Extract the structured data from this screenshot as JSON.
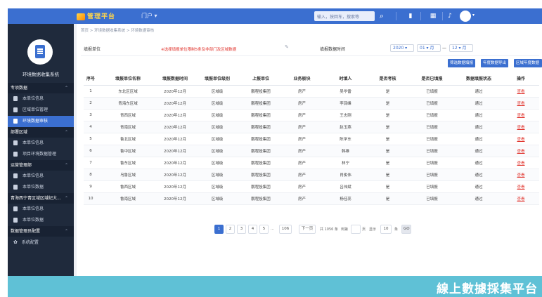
{
  "app": {
    "logo_text": "管理平台",
    "top_menu": "门户 ▾"
  },
  "header": {
    "search_placeholder": "输入，按回车，搜索等"
  },
  "sidebar": {
    "title": "环境数据收集系统",
    "groups": [
      {
        "label": "专项数据",
        "items": [
          {
            "label": "本单位信息"
          },
          {
            "label": "区域单位管理"
          },
          {
            "label": "环境数据审核",
            "active": true
          }
        ]
      },
      {
        "label": "部署区域",
        "items": [
          {
            "label": "本单位信息"
          },
          {
            "label": "项目环境数据管理"
          }
        ]
      },
      {
        "label": "运营管理部",
        "items": [
          {
            "label": "本单位信息"
          },
          {
            "label": "本单位数据"
          }
        ]
      },
      {
        "label": "青海西宁青区域区域纪大...",
        "items": [
          {
            "label": "本单位信息"
          },
          {
            "label": "本单位数据"
          }
        ]
      },
      {
        "label": "数据管理员配置",
        "items": [
          {
            "label": "系统配置",
            "gear": true
          }
        ]
      }
    ]
  },
  "breadcrumb": "首页 > 环境数据收集系统 > 环境数据审核",
  "filter": {
    "unit_label": "填报单位",
    "warning": "※选择填报单位限制5条及非部门及区域数据",
    "time_label": "填报数据时间",
    "year": "2020 ▾",
    "month_from": "01 ▾ 月",
    "dash": "—",
    "month_to": "12 ▾ 月"
  },
  "actions": [
    "筛选数据填报",
    "年度数据导出",
    "区域年度数据导出"
  ],
  "table": {
    "headers": [
      "序号",
      "填报单位名称",
      "填报数据时间",
      "填报单位级别",
      "上报单位",
      "业务板块",
      "时填人",
      "是否考核",
      "是否已填报",
      "数据填报状态",
      "操作"
    ],
    "rows": [
      [
        "1",
        "东北区区域",
        "2020年12月",
        "区域级",
        "鹏程投集团",
        "房产",
        "吴华雷",
        "是",
        "已填报",
        "通过",
        "查看"
      ],
      [
        "2",
        "青海东区域",
        "2020年12月",
        "区域级",
        "鹏程投集团",
        "房产",
        "李润峰",
        "是",
        "已填报",
        "通过",
        "查看"
      ],
      [
        "3",
        "青西区域",
        "2020年12月",
        "区域级",
        "鹏程投集团",
        "房产",
        "王志刚",
        "是",
        "已填报",
        "通过",
        "查看"
      ],
      [
        "4",
        "青南区域",
        "2020年12月",
        "区域级",
        "鹏程投集团",
        "房产",
        "赵玉燕",
        "是",
        "已填报",
        "通过",
        "查看"
      ],
      [
        "5",
        "鲁北区域",
        "2020年12月",
        "区域级",
        "鹏程投集团",
        "房产",
        "陈学东",
        "是",
        "已填报",
        "通过",
        "查看"
      ],
      [
        "6",
        "鲁中区域",
        "2020年12月",
        "区域级",
        "鹏程投集团",
        "房产",
        "韩雄",
        "是",
        "已填报",
        "通过",
        "查看"
      ],
      [
        "7",
        "鲁东区域",
        "2020年12月",
        "区域级",
        "鹏程投集团",
        "房产",
        "林宁",
        "是",
        "已填报",
        "通过",
        "查看"
      ],
      [
        "8",
        "乌鲁区域",
        "2020年12月",
        "区域级",
        "鹏程投集团",
        "房产",
        "肖俊伟",
        "是",
        "已填报",
        "通过",
        "查看"
      ],
      [
        "9",
        "鲁西区域",
        "2020年12月",
        "区域级",
        "鹏程投集团",
        "房产",
        "吕伟斌",
        "是",
        "已填报",
        "通过",
        "查看"
      ],
      [
        "10",
        "鲁南区域",
        "2020年12月",
        "区域级",
        "鹏程投集团",
        "房产",
        "杨佳蕊",
        "是",
        "已填报",
        "通过",
        "查看"
      ]
    ]
  },
  "pagination": {
    "pages": [
      "1",
      "2",
      "3",
      "4",
      "5",
      "...",
      "106"
    ],
    "next": "下一页",
    "total_text": "共 1056 条",
    "goto_text": "到第",
    "page_unit": "页",
    "per_text": "显示",
    "per_value": "10",
    "per_unit": "条",
    "go_btn": "GO"
  },
  "banner": {
    "text": "線上數據採集平台"
  },
  "colors": {
    "primary": "#3b6fd0",
    "sidebar": "#1f2a3c",
    "banner": "#5fc1d6",
    "danger": "#e0322b"
  }
}
